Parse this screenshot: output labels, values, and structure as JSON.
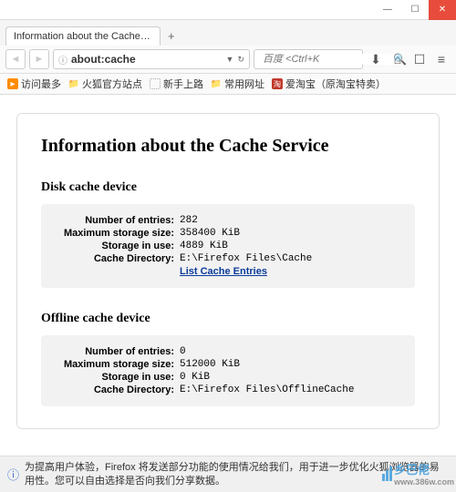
{
  "window": {
    "title": "Information about the Cache S...",
    "min": "—",
    "max": "☐",
    "close": "✕"
  },
  "tabstrip": {
    "tab_title": "Information about the Cache S...",
    "new_tab": "+"
  },
  "nav": {
    "back": "◄",
    "forward": "►",
    "url": "about:cache",
    "dropdown": "▼",
    "reload": "↻",
    "search_placeholder": "百度 <Ctrl+K",
    "search_go": "🔍",
    "downloads": "⬇",
    "home": "⌂",
    "bookmark": "☐",
    "menu": "≡"
  },
  "bookmarks": {
    "b1": "访问最多",
    "b2": "火狐官方站点",
    "b3": "新手上路",
    "b4": "常用网址",
    "b5": "爱淘宝（原淘宝特卖）"
  },
  "page": {
    "title": "Information about the Cache Service",
    "disk": {
      "heading": "Disk cache device",
      "entries_lbl": "Number of entries:",
      "entries_val": "282",
      "max_lbl": "Maximum storage size:",
      "max_val": "358400 KiB",
      "use_lbl": "Storage in use:",
      "use_val": "4889 KiB",
      "dir_lbl": "Cache Directory:",
      "dir_val": "E:\\Firefox Files\\Cache",
      "link": "List Cache Entries"
    },
    "offline": {
      "heading": "Offline cache device",
      "entries_lbl": "Number of entries:",
      "entries_val": "0",
      "max_lbl": "Maximum storage size:",
      "max_val": "512000 KiB",
      "use_lbl": "Storage in use:",
      "use_val": "0 KiB",
      "dir_lbl": "Cache Directory:",
      "dir_val": "E:\\Firefox Files\\OfflineCache"
    }
  },
  "footer": {
    "text": "为提高用户体验，Firefox 将发送部分功能的使用情况给我们，用于进一步优化火狐浏览器的易用性。您可以自由选择是否向我们分享数据。"
  },
  "watermark": {
    "main": "乡巴佬",
    "sub": "www.386w.com"
  }
}
